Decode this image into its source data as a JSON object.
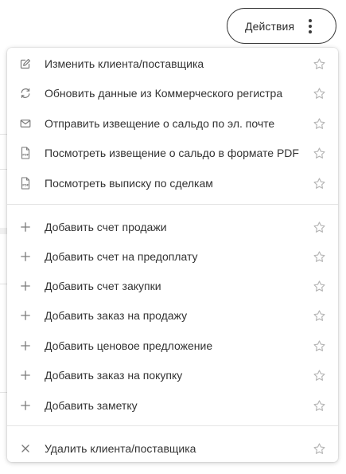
{
  "header": {
    "actions_label": "Действия"
  },
  "menu": {
    "groups": [
      {
        "items": [
          {
            "label": "Изменить клиента/поставщика",
            "icon": "edit-icon"
          },
          {
            "label": "Обновить данные из Коммерческого регистра",
            "icon": "refresh-icon"
          },
          {
            "label": "Отправить извещение о сальдо по эл. почте",
            "icon": "mail-icon"
          },
          {
            "label": "Посмотреть извещение о сальдо в формате PDF",
            "icon": "pdf-icon"
          },
          {
            "label": "Посмотреть выписку по сделкам",
            "icon": "pdf-icon"
          }
        ]
      },
      {
        "items": [
          {
            "label": "Добавить счет продажи",
            "icon": "plus-icon"
          },
          {
            "label": "Добавить счет на предоплату",
            "icon": "plus-icon"
          },
          {
            "label": "Добавить счет закупки",
            "icon": "plus-icon"
          },
          {
            "label": "Добавить заказ на продажу",
            "icon": "plus-icon"
          },
          {
            "label": "Добавить ценовое предложение",
            "icon": "plus-icon"
          },
          {
            "label": "Добавить заказ на покупку",
            "icon": "plus-icon"
          },
          {
            "label": "Добавить заметку",
            "icon": "plus-icon"
          }
        ]
      },
      {
        "items": [
          {
            "label": "Удалить клиента/поставщика",
            "icon": "close-icon"
          }
        ]
      }
    ],
    "favorite_icon": "star-outline-icon"
  },
  "colors": {
    "text": "#333333",
    "icon": "#7a7a7a",
    "star": "#b5b5b5",
    "divider": "#e4e4e4",
    "button_border": "#3a3a3a"
  }
}
